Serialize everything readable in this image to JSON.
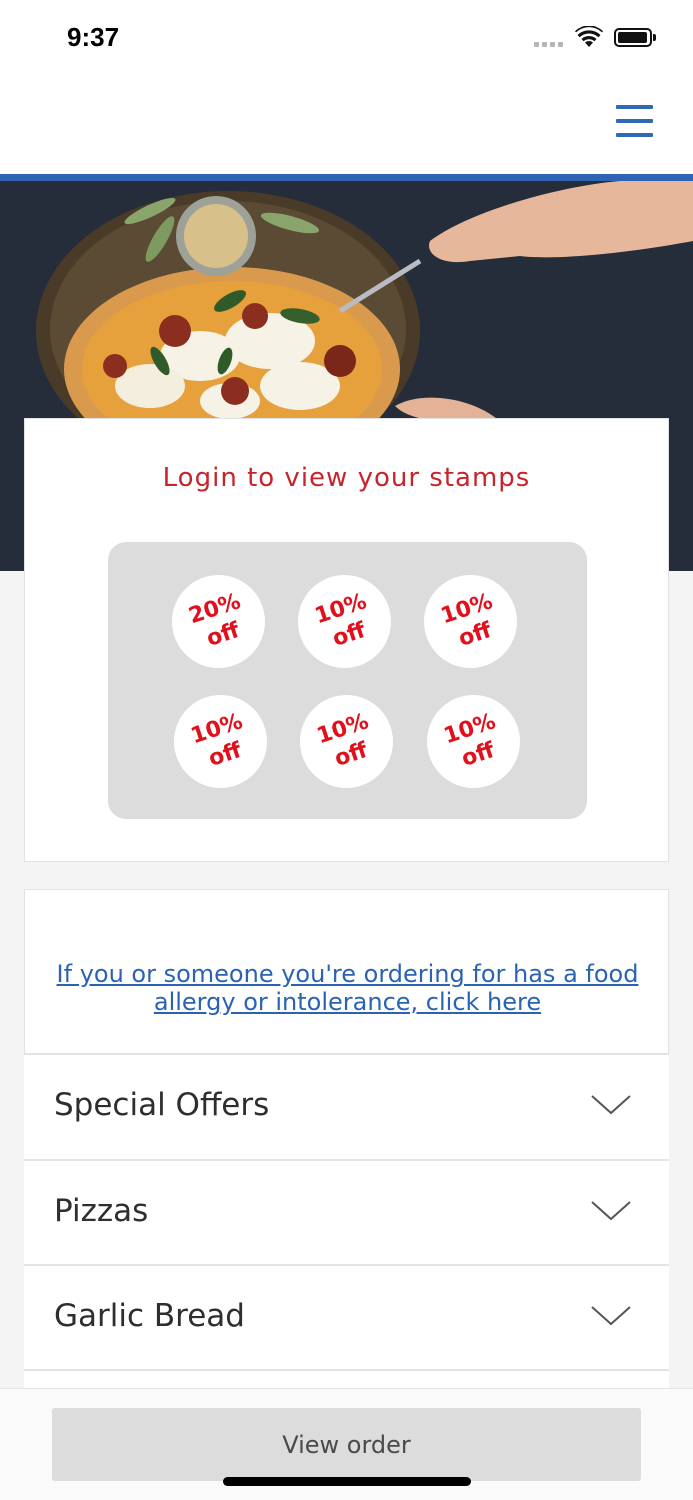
{
  "status_bar": {
    "time": "9:37"
  },
  "icons": {
    "menu": "hamburger-icon",
    "wifi": "wifi-icon",
    "battery": "battery-icon",
    "cellular": "signal-dots-icon",
    "expand": "chevron-down-icon"
  },
  "colors": {
    "brand_blue": "#2f64b5",
    "stamp_red": "#e0101c",
    "title_red": "#c8242b",
    "link_blue": "#2a63b5"
  },
  "stamp_card": {
    "title": "Login to view your stamps",
    "stamps": [
      {
        "percent": "20%",
        "label": "off"
      },
      {
        "percent": "10%",
        "label": "off"
      },
      {
        "percent": "10%",
        "label": "off"
      },
      {
        "percent": "10%",
        "label": "off"
      },
      {
        "percent": "10%",
        "label": "off"
      },
      {
        "percent": "10%",
        "label": "off"
      }
    ]
  },
  "menu": {
    "allergy_link": "If you or someone you're ordering for has a food allergy or intolerance, click here",
    "categories": [
      {
        "label": "Special Offers"
      },
      {
        "label": "Pizzas"
      },
      {
        "label": "Garlic Bread"
      }
    ]
  },
  "footer": {
    "view_order_label": "View order"
  }
}
